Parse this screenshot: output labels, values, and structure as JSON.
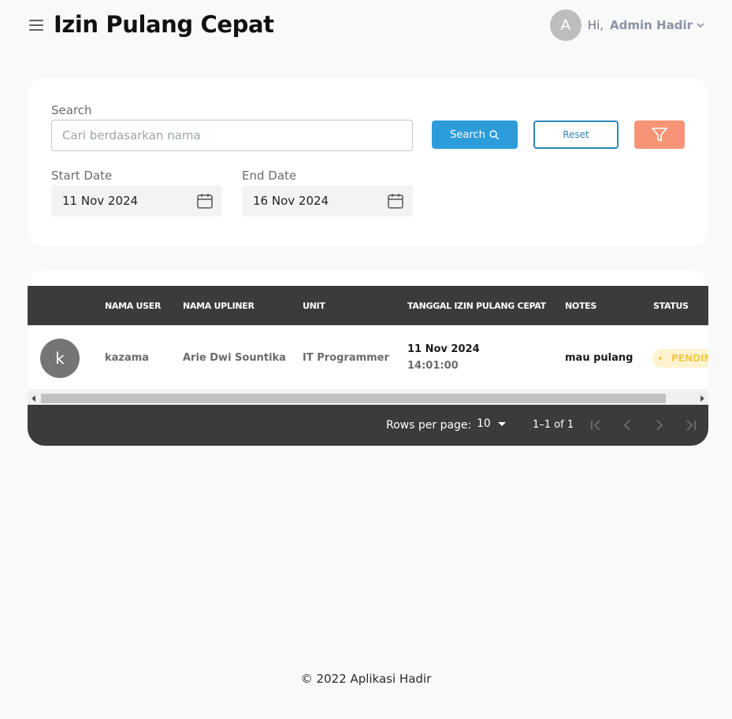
{
  "header": {
    "title": "Izin Pulang Cepat",
    "avatar_initial": "A",
    "greeting": "Hi,",
    "user_name": "Admin Hadir"
  },
  "filters": {
    "search_label": "Search",
    "search_placeholder": "Cari berdasarkan nama",
    "search_value": "",
    "search_button": "Search",
    "reset_button": "Reset",
    "start_date_label": "Start Date",
    "start_date_value": "11 Nov 2024",
    "end_date_label": "End Date",
    "end_date_value": "16 Nov 2024"
  },
  "table": {
    "columns": [
      "",
      "NAMA USER",
      "NAMA UPLINER",
      "UNIT",
      "TANGGAL IZIN PULANG CEPAT",
      "NOTES",
      "STATUS"
    ],
    "rows": [
      {
        "avatar_initial": "k",
        "nama_user": "kazama",
        "nama_upliner": "Arie Dwi Sountika",
        "unit": "IT Programmer",
        "tanggal": "11 Nov 2024",
        "jam": "14:01:00",
        "notes": "mau pulang",
        "status": "PENDING"
      }
    ]
  },
  "pagination": {
    "rows_per_page_label": "Rows per page:",
    "rows_per_page_value": "10",
    "range": "1–1 of 1"
  },
  "footer": {
    "copyright": "© 2022 Aplikasi Hadir"
  },
  "colors": {
    "primary": "#2d9cdb",
    "filter": "#f79476",
    "table_header": "#3b3b3b",
    "status_pending_bg": "#fdf3d0",
    "status_pending_text": "#f2c94c"
  }
}
